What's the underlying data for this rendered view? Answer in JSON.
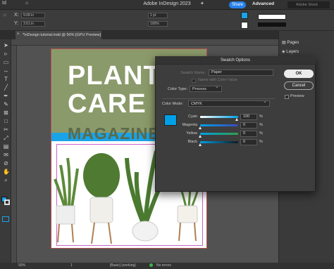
{
  "menubar": {
    "app_title": "Adobe InDesign 2023",
    "share_label": "Share",
    "workspace_label": "Advanced",
    "search_placeholder": "Adobe Stock"
  },
  "controlbar": {
    "x_value": "9.68 in",
    "y_value": "3.61 in",
    "stroke_weight": "1 pt",
    "zoom": "100%"
  },
  "document": {
    "tab_label": "*InDesign tutorial.indd @ 50% [GPU Preview]"
  },
  "page": {
    "title_line1": "PLANT",
    "title_line2": "CARE",
    "title_line3": "MAGAZINE"
  },
  "panels": {
    "pages_label": "Pages",
    "layers_label": "Layers"
  },
  "status": {
    "zoom": "50%",
    "page": "1",
    "style": "[Basic] (working)",
    "preflight": "No errors"
  },
  "dialog": {
    "title": "Swatch Options",
    "swatch_name_label": "Swatch Name:",
    "swatch_name_value": "Paper",
    "name_with_color_value": "Name with Color Value",
    "color_type_label": "Color Type:",
    "color_type_value": "Process",
    "color_mode_label": "Color Mode:",
    "color_mode_value": "CMYK",
    "ok_label": "OK",
    "cancel_label": "Cancel",
    "preview_label": "Preview",
    "channels": [
      {
        "name": "Cyan",
        "value": "100"
      },
      {
        "name": "Magenta",
        "value": "0"
      },
      {
        "name": "Yellow",
        "value": "0"
      },
      {
        "name": "Black",
        "value": "0"
      }
    ],
    "percent": "%",
    "swatch_color": "#00A0E6"
  }
}
